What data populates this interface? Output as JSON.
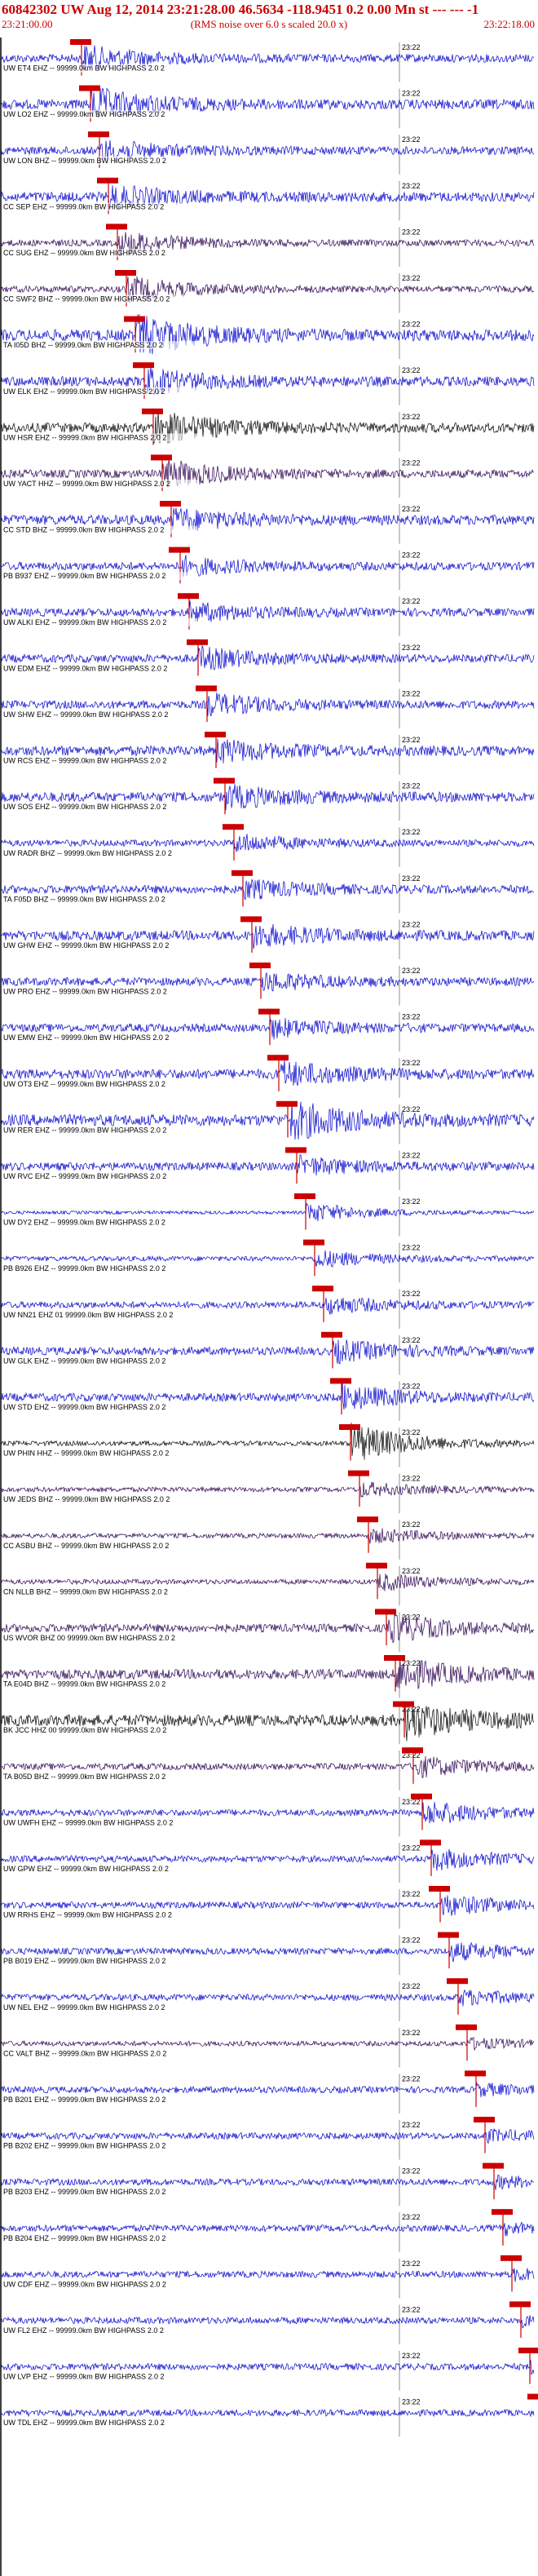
{
  "header": {
    "title": "60842302 UW Aug 12, 2014 23:21:28.00   46.5634 -118.9451  0.2 0.00 Mn st --- --- -1",
    "start_time": "23:21:00.00",
    "subtitle": "(RMS noise over 6.0 s scaled 20.0 x)",
    "end_time": "23:22:18.00"
  },
  "minute_mark": "23:22",
  "colors": {
    "red": "#cc0000",
    "blue": "#0000cc",
    "purple": "#2a0050",
    "black": "#000000",
    "grid": "#999999"
  },
  "stations": [
    {
      "label": "UW ET4 EHZ -- 99999.0km BW  HIGHPASS  2.0  2",
      "color": "blue",
      "amp": 5,
      "burst_amp": 14
    },
    {
      "label": "UW LO2 EHZ -- 99999.0km BW  HIGHPASS  2.0  2",
      "color": "blue",
      "amp": 6,
      "burst_amp": 18
    },
    {
      "label": "UW LON BHZ -- 99999.0km BW  HIGHPASS  2.0  2",
      "color": "blue",
      "amp": 5,
      "burst_amp": 12
    },
    {
      "label": "CC SEP EHZ -- 99999.0km BW  HIGHPASS  2.0  2",
      "color": "blue",
      "amp": 6,
      "burst_amp": 12
    },
    {
      "label": "CC SUG EHZ -- 99999.0km BW  HIGHPASS  2.0  2",
      "color": "purple",
      "amp": 4,
      "burst_amp": 14
    },
    {
      "label": "CC SWF2 BHZ -- 99999.0km BW  HIGHPASS  2.0  2",
      "color": "purple",
      "amp": 4,
      "burst_amp": 14
    },
    {
      "label": "TA I05D BHZ -- 99999.0km BW  HIGHPASS  2.0  2",
      "color": "blue",
      "amp": 7,
      "burst_amp": 22
    },
    {
      "label": "UW ELK EHZ -- 99999.0km BW  HIGHPASS  2.0  2",
      "color": "blue",
      "amp": 6,
      "burst_amp": 14
    },
    {
      "label": "UW HSR EHZ -- 99999.0km BW  HIGHPASS  2.0  2",
      "color": "black",
      "amp": 6,
      "burst_amp": 18
    },
    {
      "label": "UW YACT HHZ -- 99999.0km BW  HIGHPASS  2.0  2",
      "color": "purple",
      "amp": 5,
      "burst_amp": 16
    },
    {
      "label": "CC STD BHZ -- 99999.0km BW  HIGHPASS  2.0  2",
      "color": "blue",
      "amp": 6,
      "burst_amp": 12
    },
    {
      "label": "PB B937 EHZ -- 99999.0km BW  HIGHPASS  2.0  2",
      "color": "blue",
      "amp": 5,
      "burst_amp": 10
    },
    {
      "label": "UW ALKI EHZ -- 99999.0km BW  HIGHPASS  2.0  2",
      "color": "blue",
      "amp": 5,
      "burst_amp": 10
    },
    {
      "label": "UW EDM EHZ -- 99999.0km BW  HIGHPASS  2.0  2",
      "color": "blue",
      "amp": 5,
      "burst_amp": 12
    },
    {
      "label": "UW SHW EHZ -- 99999.0km BW  HIGHPASS  2.0  2",
      "color": "blue",
      "amp": 5,
      "burst_amp": 12
    },
    {
      "label": "UW RCS EHZ -- 99999.0km BW  HIGHPASS  2.0  2",
      "color": "blue",
      "amp": 6,
      "burst_amp": 12
    },
    {
      "label": "UW SOS EHZ -- 99999.0km BW  HIGHPASS  2.0  2",
      "color": "blue",
      "amp": 6,
      "burst_amp": 12
    },
    {
      "label": "UW RADR BHZ -- 99999.0km BW  HIGHPASS  2.0  2",
      "color": "blue",
      "amp": 4,
      "burst_amp": 10
    },
    {
      "label": "TA F05D BHZ -- 99999.0km BW  HIGHPASS  2.0  2",
      "color": "blue",
      "amp": 5,
      "burst_amp": 10
    },
    {
      "label": "UW GHW EHZ -- 99999.0km BW  HIGHPASS  2.0  2",
      "color": "blue",
      "amp": 6,
      "burst_amp": 12
    },
    {
      "label": "UW PRO EHZ -- 99999.0km BW  HIGHPASS  2.0  2",
      "color": "blue",
      "amp": 5,
      "burst_amp": 10
    },
    {
      "label": "UW EMW EHZ -- 99999.0km BW  HIGHPASS  2.0  2",
      "color": "blue",
      "amp": 5,
      "burst_amp": 10
    },
    {
      "label": "UW OT3 EHZ -- 99999.0km BW  HIGHPASS  2.0  2",
      "color": "blue",
      "amp": 6,
      "burst_amp": 14
    },
    {
      "label": "UW RER EHZ -- 99999.0km BW  HIGHPASS  2.0  2",
      "color": "blue",
      "amp": 7,
      "burst_amp": 22
    },
    {
      "label": "UW RVC EHZ -- 99999.0km BW  HIGHPASS  2.0  2",
      "color": "blue",
      "amp": 5,
      "burst_amp": 10
    },
    {
      "label": "UW DY2 EHZ -- 99999.0km BW  HIGHPASS  2.0  2",
      "color": "blue",
      "amp": 2,
      "burst_amp": 12
    },
    {
      "label": "PB B926 EHZ -- 99999.0km BW  HIGHPASS  2.0  2",
      "color": "blue",
      "amp": 3,
      "burst_amp": 10
    },
    {
      "label": "UW NN21 EHZ 01 99999.0km BW  HIGHPASS  2.0  2",
      "color": "blue",
      "amp": 4,
      "burst_amp": 10
    },
    {
      "label": "UW GLK EHZ -- 99999.0km BW  HIGHPASS  2.0  2",
      "color": "blue",
      "amp": 5,
      "burst_amp": 12
    },
    {
      "label": "UW STD EHZ -- 99999.0km BW  HIGHPASS  2.0  2",
      "color": "blue",
      "amp": 5,
      "burst_amp": 14
    },
    {
      "label": "UW PHIN HHZ -- 99999.0km BW  HIGHPASS  2.0  2",
      "color": "black",
      "amp": 3,
      "burst_amp": 24
    },
    {
      "label": "UW JEDS BHZ -- 99999.0km BW  HIGHPASS  2.0  2",
      "color": "purple",
      "amp": 3,
      "burst_amp": 8
    },
    {
      "label": "CC ASBU BHZ -- 99999.0km BW  HIGHPASS  2.0  2",
      "color": "purple",
      "amp": 3,
      "burst_amp": 8
    },
    {
      "label": "CN NLLB BHZ -- 99999.0km BW  HIGHPASS  2.0  2",
      "color": "purple",
      "amp": 3,
      "burst_amp": 10
    },
    {
      "label": "US WVOR BHZ 00 99999.0km BW  HIGHPASS  2.0  2",
      "color": "purple",
      "amp": 5,
      "burst_amp": 16
    },
    {
      "label": "TA E04D BHZ -- 99999.0km BW  HIGHPASS  2.0  2",
      "color": "purple",
      "amp": 6,
      "burst_amp": 18
    },
    {
      "label": "BK JCC HHZ 00 99999.0km BW  HIGHPASS  2.0  2",
      "color": "black",
      "amp": 7,
      "burst_amp": 20
    },
    {
      "label": "TA B05D BHZ -- 99999.0km BW  HIGHPASS  2.0  2",
      "color": "purple",
      "amp": 4,
      "burst_amp": 12
    },
    {
      "label": "UW UWFH EHZ -- 99999.0km BW  HIGHPASS  2.0  2",
      "color": "blue",
      "amp": 4,
      "burst_amp": 14
    },
    {
      "label": "UW GPW EHZ -- 99999.0km BW  HIGHPASS  2.0  2",
      "color": "blue",
      "amp": 4,
      "burst_amp": 12
    },
    {
      "label": "UW RRHS EHZ -- 99999.0km BW  HIGHPASS  2.0  2",
      "color": "blue",
      "amp": 4,
      "burst_amp": 12
    },
    {
      "label": "PB B019 EHZ -- 99999.0km BW  HIGHPASS  2.0  2",
      "color": "blue",
      "amp": 4,
      "burst_amp": 10
    },
    {
      "label": "UW NEL EHZ -- 99999.0km BW  HIGHPASS  2.0  2",
      "color": "blue",
      "amp": 4,
      "burst_amp": 8
    },
    {
      "label": "CC VALT BHZ -- 99999.0km BW  HIGHPASS  2.0  2",
      "color": "purple",
      "amp": 3,
      "burst_amp": 6
    },
    {
      "label": "PB B201 EHZ -- 99999.0km BW  HIGHPASS  2.0  2",
      "color": "blue",
      "amp": 4,
      "burst_amp": 6
    },
    {
      "label": "PB B202 EHZ -- 99999.0km BW  HIGHPASS  2.0  2",
      "color": "blue",
      "amp": 4,
      "burst_amp": 6
    },
    {
      "label": "PB B203 EHZ -- 99999.0km BW  HIGHPASS  2.0  2",
      "color": "blue",
      "amp": 4,
      "burst_amp": 6
    },
    {
      "label": "PB B204 EHZ -- 99999.0km BW  HIGHPASS  2.0  2",
      "color": "blue",
      "amp": 4,
      "burst_amp": 6
    },
    {
      "label": "UW CDF EHZ -- 99999.0km BW  HIGHPASS  2.0  2",
      "color": "blue",
      "amp": 4,
      "burst_amp": 6
    },
    {
      "label": "UW FL2 EHZ -- 99999.0km BW  HIGHPASS  2.0  2",
      "color": "blue",
      "amp": 4,
      "burst_amp": 6
    },
    {
      "label": "UW LVP EHZ -- 99999.0km BW  HIGHPASS  2.0  2",
      "color": "blue",
      "amp": 4,
      "burst_amp": 6
    },
    {
      "label": "UW TDL EHZ -- 99999.0km BW  HIGHPASS  2.0  2",
      "color": "blue",
      "amp": 4,
      "burst_amp": 6
    }
  ]
}
